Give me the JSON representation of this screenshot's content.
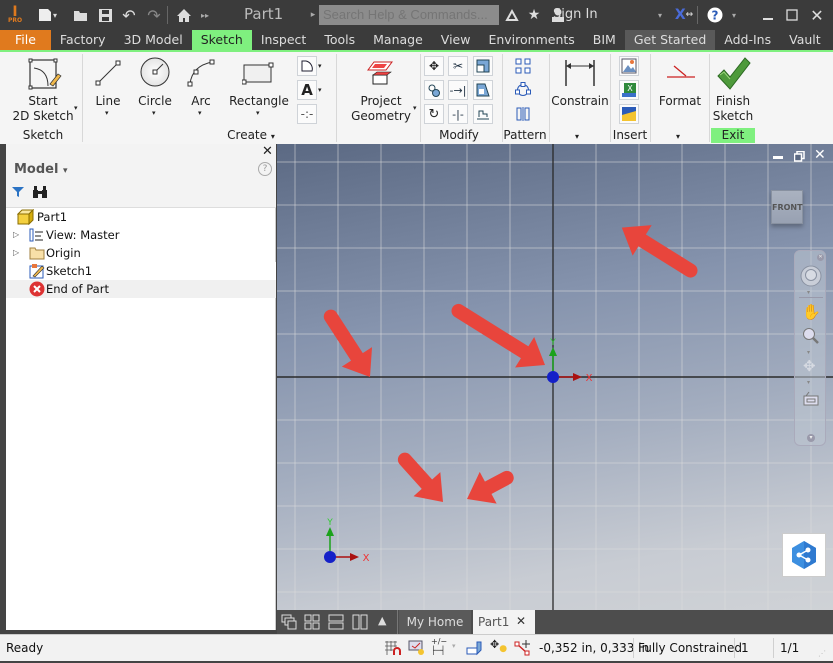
{
  "titlebar": {
    "app_icon": "inventor-pro-icon",
    "doc_title": "Part1",
    "search_placeholder": "Search Help & Commands...",
    "sign_in": "Sign In"
  },
  "menu_tabs": [
    {
      "label": "File"
    },
    {
      "label": "Factory"
    },
    {
      "label": "3D Model"
    },
    {
      "label": "Sketch"
    },
    {
      "label": "Inspect"
    },
    {
      "label": "Tools"
    },
    {
      "label": "Manage"
    },
    {
      "label": "View"
    },
    {
      "label": "Environments"
    },
    {
      "label": "BIM"
    },
    {
      "label": "Get Started"
    },
    {
      "label": "Add-Ins"
    },
    {
      "label": "Vault"
    }
  ],
  "ribbon": {
    "start_sketch": {
      "line1": "Start",
      "line2": "2D Sketch"
    },
    "line": "Line",
    "circle": "Circle",
    "arc": "Arc",
    "rectangle": "Rectangle",
    "project_geometry": {
      "line1": "Project",
      "line2": "Geometry"
    },
    "constrain": "Constrain",
    "format": "Format",
    "finish_sketch": {
      "line1": "Finish",
      "line2": "Sketch"
    },
    "groups": {
      "sketch": "Sketch",
      "create": "Create",
      "modify": "Modify",
      "pattern": "Pattern",
      "insert": "Insert",
      "exit": "Exit"
    },
    "text_glyph": "A"
  },
  "panel": {
    "title": "Model",
    "tree": [
      {
        "label": "Part1",
        "icon": "part-icon"
      },
      {
        "label": "View: Master",
        "icon": "view-rep-icon"
      },
      {
        "label": "Origin",
        "icon": "folder-icon"
      },
      {
        "label": "Sketch1",
        "icon": "sketch-icon"
      },
      {
        "label": "End of Part",
        "icon": "end-of-part-icon"
      }
    ]
  },
  "viewport": {
    "viewcube_label": "FRONT",
    "axis_x": "X",
    "axis_y": "Y"
  },
  "doc_tabs": {
    "home": "My Home",
    "part": "Part1"
  },
  "status": {
    "ready": "Ready",
    "coords": "-0,352 in, 0,333 in",
    "constraint": "Fully Constrained",
    "count": "1",
    "page": "1/1"
  },
  "colors": {
    "file_tab": "#e07a1e",
    "active_tab": "#7ff07f",
    "annotation_arrow": "#e8453c"
  }
}
